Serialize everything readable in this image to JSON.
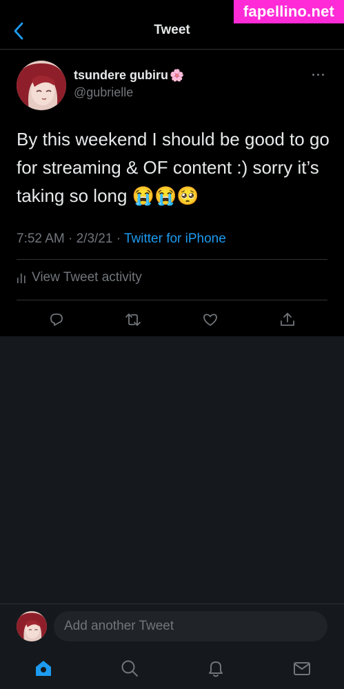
{
  "header": {
    "title": "Tweet",
    "back_icon": "chevron-left-icon"
  },
  "watermark": {
    "text": "fapellino.net"
  },
  "tweet": {
    "author_name": "tsundere gubiru",
    "author_name_emoji": "🌸",
    "handle": "@gubrielle",
    "text": "By this weekend I should be good to go for streaming & OF content :) sorry it’s taking so long 😭😭🥺",
    "time": "7:52 AM · 2/3/21 · ",
    "source": "Twitter for iPhone",
    "activity_label": "View Tweet activity"
  },
  "actions": [
    "reply-icon",
    "retweet-icon",
    "like-icon",
    "share-icon"
  ],
  "compose": {
    "placeholder": "Add another Tweet"
  },
  "tabbar": [
    "home-icon",
    "search-icon",
    "notifications-icon",
    "messages-icon"
  ],
  "colors": {
    "accent": "#1d9bf0",
    "background": "#15181c",
    "tweet_bg": "#000000",
    "watermark": "#ff2bd7"
  }
}
